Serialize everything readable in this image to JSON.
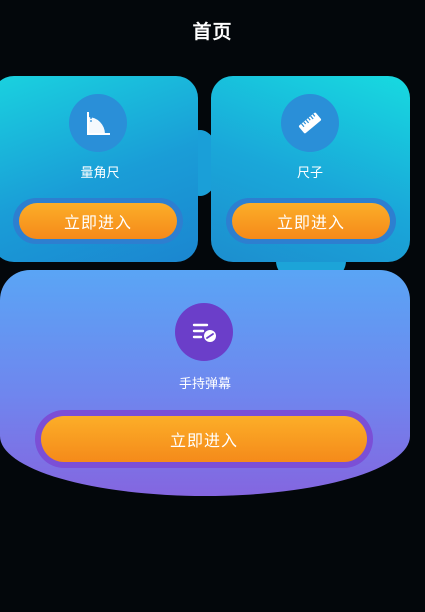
{
  "header": {
    "title": "首页"
  },
  "cards": [
    {
      "label": "量角尺",
      "button_label": "立即进入",
      "icon": "protractor-icon"
    },
    {
      "label": "尺子",
      "button_label": "立即进入",
      "icon": "ruler-icon"
    },
    {
      "label": "手持弹幕",
      "button_label": "立即进入",
      "icon": "barrage-icon"
    }
  ],
  "colors": {
    "background": "#03070b",
    "cyan_card": "#1ad2df",
    "blue_card": "#1b86d0",
    "purple_card": "#8466e0",
    "button_orange": "#f58a1a"
  }
}
